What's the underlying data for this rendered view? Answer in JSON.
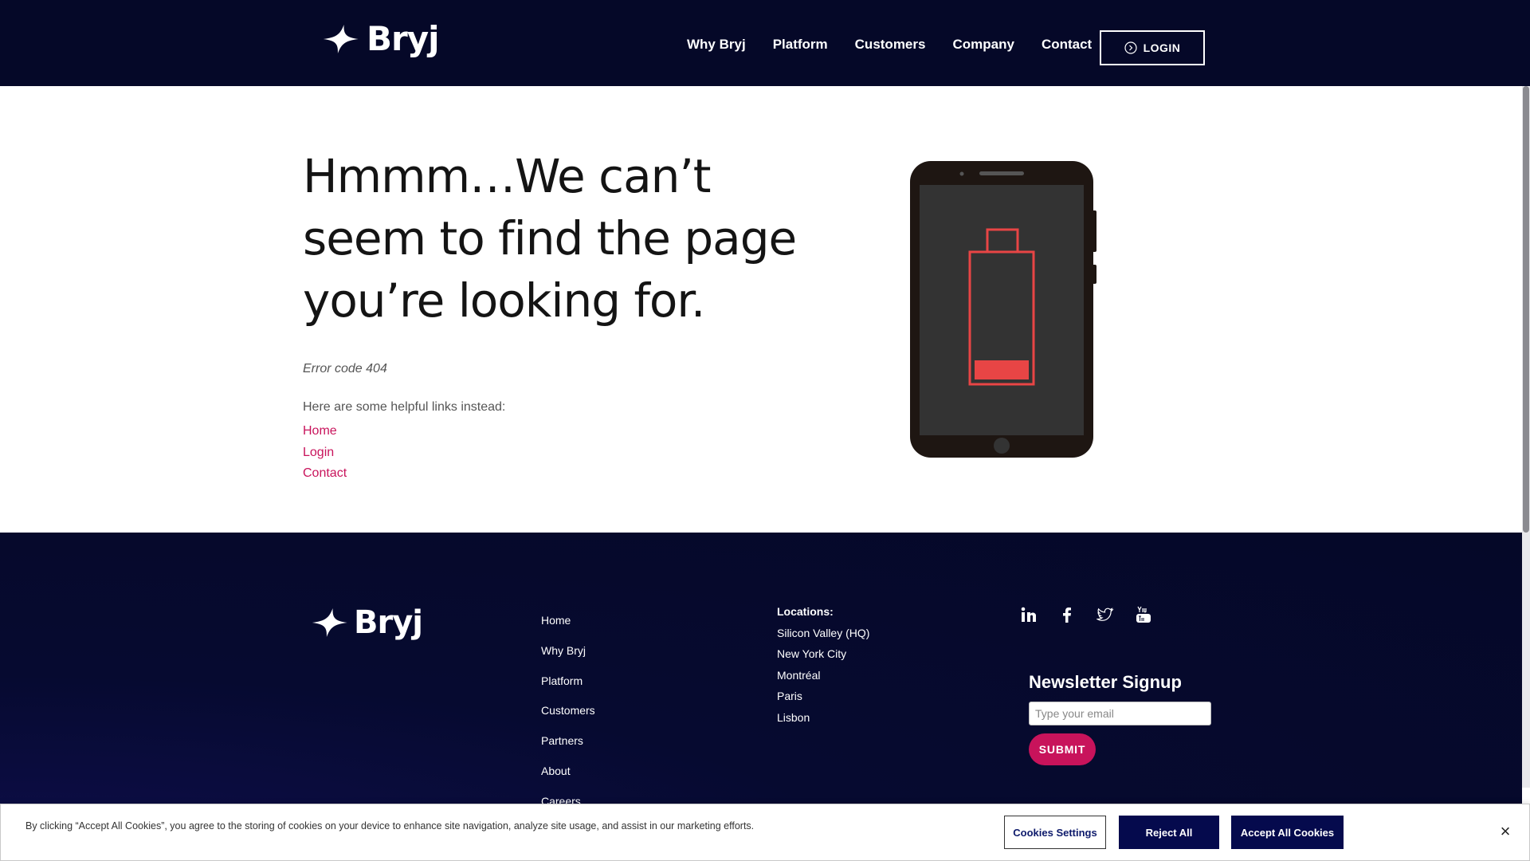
{
  "header": {
    "brand": "Bryj",
    "nav": [
      "Why Bryj",
      "Platform",
      "Customers",
      "Company",
      "Contact"
    ],
    "login_label": "LOGIN"
  },
  "main": {
    "title": "Hmmm…We can’t seem to find the page you’re looking for.",
    "error_code": "Error code 404",
    "helpful_text": "Here are some helpful links instead:",
    "links": [
      "Home",
      "Login",
      "Contact"
    ]
  },
  "footer": {
    "brand": "Bryj",
    "links": [
      "Home",
      "Why Bryj",
      "Platform",
      "Customers",
      "Partners",
      "About",
      "Careers"
    ],
    "locations_heading": "Locations:",
    "locations": [
      "Silicon Valley (HQ)",
      "New York City",
      "Montréal",
      "Paris",
      "Lisbon"
    ],
    "socials": [
      "linkedin-icon",
      "facebook-icon",
      "twitter-icon",
      "youtube-icon"
    ],
    "newsletter_title": "Newsletter Signup",
    "email_placeholder": "Type your email",
    "submit_label": "SUBMIT"
  },
  "cookie_banner": {
    "text": "By clicking “Accept All Cookies”, you agree to the storing of cookies on your device to enhance site navigation, analyze site usage, and assist in our marketing efforts.",
    "settings_label": "Cookies Settings",
    "reject_label": "Reject All",
    "accept_label": "Accept All Cookies",
    "close_glyph": "×"
  },
  "colors": {
    "navy": "#050828",
    "accent_pink": "#c8135b",
    "battery_red": "#e84545",
    "button_navy": "#050a4d"
  }
}
